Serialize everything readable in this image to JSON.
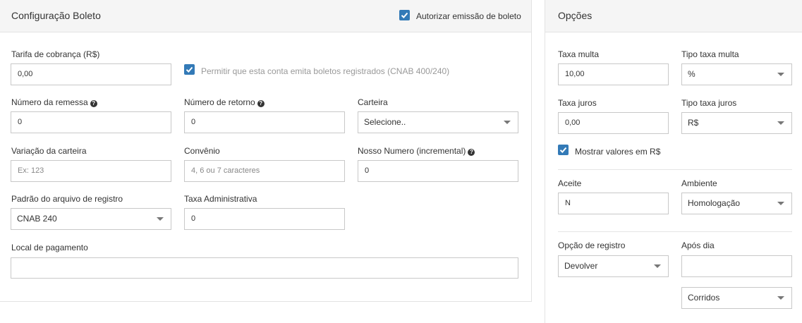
{
  "left_panel": {
    "title": "Configuração Boleto",
    "authorize_checkbox": {
      "label": "Autorizar emissão de boleto",
      "checked": true
    },
    "tarifa": {
      "label": "Tarifa de cobrança (R$)",
      "value": "0,00"
    },
    "registrados_checkbox": {
      "label": "Permitir que esta conta emita boletos registrados (CNAB 400/240)",
      "checked": true
    },
    "numero_remessa": {
      "label": "Número da remessa",
      "value": "0"
    },
    "numero_retorno": {
      "label": "Número de retorno",
      "value": "0"
    },
    "carteira": {
      "label": "Carteira",
      "value": "Selecione.."
    },
    "variacao_carteira": {
      "label": "Variação da carteira",
      "placeholder": "Ex: 123"
    },
    "convenio": {
      "label": "Convênio",
      "placeholder": "4, 6 ou 7 caracteres"
    },
    "nosso_numero": {
      "label": "Nosso Numero (incremental)",
      "value": "0"
    },
    "padrao_arquivo": {
      "label": "Padrão do arquivo de registro",
      "value": "CNAB 240"
    },
    "taxa_admin": {
      "label": "Taxa Administrativa",
      "value": "0"
    },
    "local_pagamento": {
      "label": "Local de pagamento",
      "value": ""
    }
  },
  "right_panel": {
    "title": "Opções",
    "taxa_multa": {
      "label": "Taxa multa",
      "value": "10,00"
    },
    "tipo_taxa_multa": {
      "label": "Tipo taxa multa",
      "value": "%"
    },
    "taxa_juros": {
      "label": "Taxa juros",
      "value": "0,00"
    },
    "tipo_taxa_juros": {
      "label": "Tipo taxa juros",
      "value": "R$"
    },
    "mostrar_valores": {
      "label": "Mostrar valores em R$",
      "checked": true
    },
    "aceite": {
      "label": "Aceite",
      "value": "N"
    },
    "ambiente": {
      "label": "Ambiente",
      "value": "Homologação"
    },
    "opcao_registro": {
      "label": "Opção de registro",
      "value": "Devolver"
    },
    "apos_dia": {
      "label": "Após dia",
      "value": ""
    },
    "dias_tipo": {
      "value": "Corridos"
    }
  },
  "colors": {
    "accent": "#337ab7",
    "border": "#c8c8c8",
    "header_bg": "#f5f5f5"
  }
}
